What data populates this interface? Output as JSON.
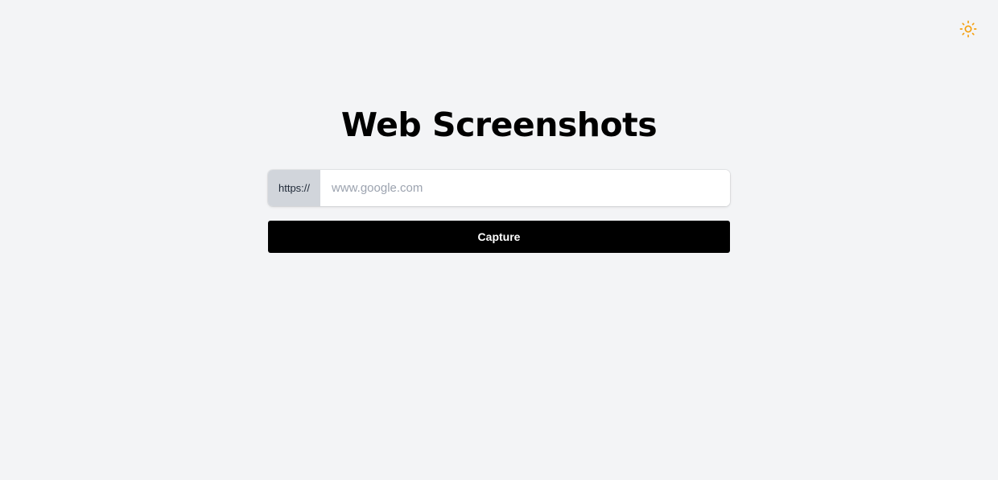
{
  "header": {
    "theme_toggle_icon": "sun-icon",
    "accent_color": "#f59e0b"
  },
  "main": {
    "title": "Web Screenshots",
    "url_prefix": "https://",
    "url_input": {
      "value": "",
      "placeholder": "www.google.com"
    },
    "capture_label": "Capture"
  },
  "colors": {
    "background": "#f3f4f6",
    "button": "#000000",
    "prefix_bg": "#d1d5db"
  }
}
